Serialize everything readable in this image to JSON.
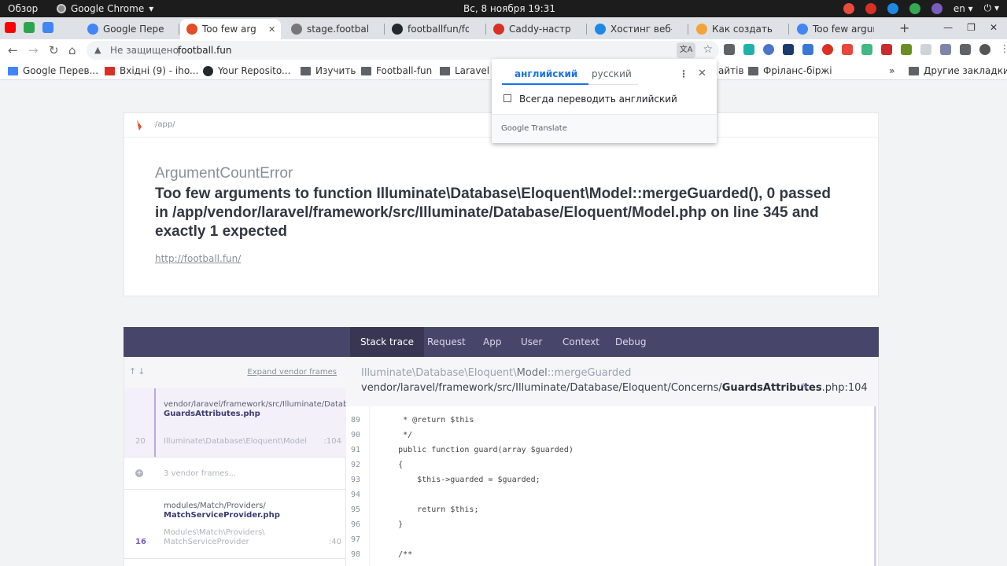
{
  "system_bar": {
    "overview": "Обзор",
    "app_name": "Google Chrome",
    "app_arrow": "▾",
    "clock": "Вс, 8 ноября  19:31",
    "lang": "en ▾",
    "power": "⏻ ▾"
  },
  "tabs": [
    {
      "title": "Google Перев",
      "icon_color": "#4285f4"
    },
    {
      "title": "Too few arg",
      "icon_color": "#e34c26"
    },
    {
      "title": "stage.footbal",
      "icon_color": "#777777"
    },
    {
      "title": "footballfun/fo",
      "icon_color": "#24292e"
    },
    {
      "title": "Caddy-настро",
      "icon_color": "#d93025"
    },
    {
      "title": "Хостинг веб-с",
      "icon_color": "#1e88e5"
    },
    {
      "title": "Как создать ф",
      "icon_color": "#f2a33a"
    },
    {
      "title": "Too few argun",
      "icon_color": "#4285f4"
    }
  ],
  "toolbar": {
    "back": "←",
    "forward": "→",
    "reload": "↻",
    "home": "⌂",
    "warning_icon": "▲",
    "insecure_label": "Не защищено",
    "separator": "|",
    "url": "football.fun",
    "translate_icon": "文A",
    "star": "☆"
  },
  "bookmarks": [
    {
      "label": "Google Перев..."
    },
    {
      "label": "Вхідні (9) - iho..."
    },
    {
      "label": "Your Reposito..."
    },
    {
      "label": "Изучить"
    },
    {
      "label": "Football-fun"
    },
    {
      "label": "Laravel"
    },
    {
      "label": "айтів"
    },
    {
      "label": "Фріланс-біржі"
    },
    {
      "label": "»"
    },
    {
      "label": "Другие закладки"
    }
  ],
  "translate_popup": {
    "lang_from": "английский",
    "lang_to": "русский",
    "menu": "⋮",
    "close": "✕",
    "always_label": "Всегда переводить английский",
    "footer": "Google Translate"
  },
  "error": {
    "breadcrumb": "/app/",
    "class": "ArgumentCountError",
    "message": "Too few arguments to function Illuminate\\Database\\Eloquent\\Model::mergeGuarded(), 0 passed in /app/vendor/laravel/framework/src/Illuminate/Database/Eloquent/Model.php on line 345 and exactly 1 expected",
    "url": "http://football.fun/"
  },
  "nav_tabs": [
    "Stack trace",
    "Request",
    "App",
    "User",
    "Context",
    "Debug"
  ],
  "frames_panel": {
    "arrows": "↑↓",
    "expand_label": "Expand vendor frames",
    "frames": [
      {
        "number": "20",
        "path": "vendor/laravel/framework/src/Illuminate/Database/Eloquent/Concerns/",
        "file": "GuardsAttributes.php",
        "class": "Illuminate\\Database\\Eloquent\\Model",
        "line": ":104"
      },
      {
        "vendor_label": "3 vendor frames...",
        "plus": "+"
      },
      {
        "number": "16",
        "path": "modules/Match/Providers/",
        "file": "MatchServiceProvider.php",
        "class_1": "Modules\\Match\\Providers\\",
        "class_2": "MatchServiceProvider",
        "line": ":40"
      }
    ]
  },
  "code_panel": {
    "class_prefix": "Illuminate\\Database\\Eloquent\\",
    "class_name": "Model",
    "method": "::mergeGuarded",
    "file_prefix": "vendor/laravel/framework/src/Illuminate/Database/Eloquent/Concerns/",
    "file_name": "GuardsAttributes",
    "file_suffix": ".php:104",
    "pencil": "✎",
    "lines": [
      {
        "n": "89",
        "code": "     * @return $this"
      },
      {
        "n": "90",
        "code": "     */"
      },
      {
        "n": "91",
        "code": "    public function guard(array $guarded)"
      },
      {
        "n": "92",
        "code": "    {"
      },
      {
        "n": "93",
        "code": "        $this->guarded = $guarded;"
      },
      {
        "n": "94",
        "code": ""
      },
      {
        "n": "95",
        "code": "        return $this;"
      },
      {
        "n": "96",
        "code": "    }"
      },
      {
        "n": "97",
        "code": ""
      },
      {
        "n": "98",
        "code": "    /**"
      }
    ]
  },
  "colors": {
    "nav_bg": "#48456a",
    "nav_active": "#393654",
    "accent": "#7b5cbf"
  }
}
